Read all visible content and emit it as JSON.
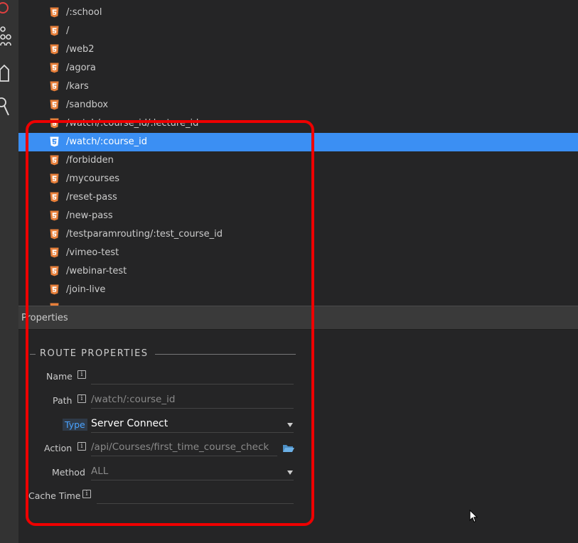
{
  "colors": {
    "selected_row": "#3b8ff3",
    "html5_icon": "#e77f3a",
    "annotation": "#ee0000",
    "type_label": "#4aa3ff"
  },
  "activity_bar": {
    "icons": [
      "record-icon",
      "git-branch-icon",
      "tag-icon",
      "search-icon"
    ]
  },
  "routes": [
    {
      "label": "/:school"
    },
    {
      "label": "/"
    },
    {
      "label": "/web2"
    },
    {
      "label": "/agora"
    },
    {
      "label": "/kars"
    },
    {
      "label": "/sandbox"
    },
    {
      "label": "/watch/:course_id/:lecture_id"
    },
    {
      "label": "/watch/:course_id"
    },
    {
      "label": "/forbidden"
    },
    {
      "label": "/mycourses"
    },
    {
      "label": "/reset-pass"
    },
    {
      "label": "/new-pass"
    },
    {
      "label": "/testparamrouting/:test_course_id"
    },
    {
      "label": "/vimeo-test"
    },
    {
      "label": "/webinar-test"
    },
    {
      "label": "/join-live"
    }
  ],
  "selected_route_index": 7,
  "properties": {
    "header": "Properties",
    "section_title": "ROUTE PROPERTIES",
    "name_label": "Name",
    "name_value": "",
    "path_label": "Path",
    "path_value": "/watch/:course_id",
    "type_label": "Type",
    "type_value": "Server Connect",
    "action_label": "Action",
    "action_value": "/api/Courses/first_time_course_check",
    "method_label": "Method",
    "method_value": "ALL",
    "cache_label": "Cache Time",
    "cache_value": ""
  }
}
